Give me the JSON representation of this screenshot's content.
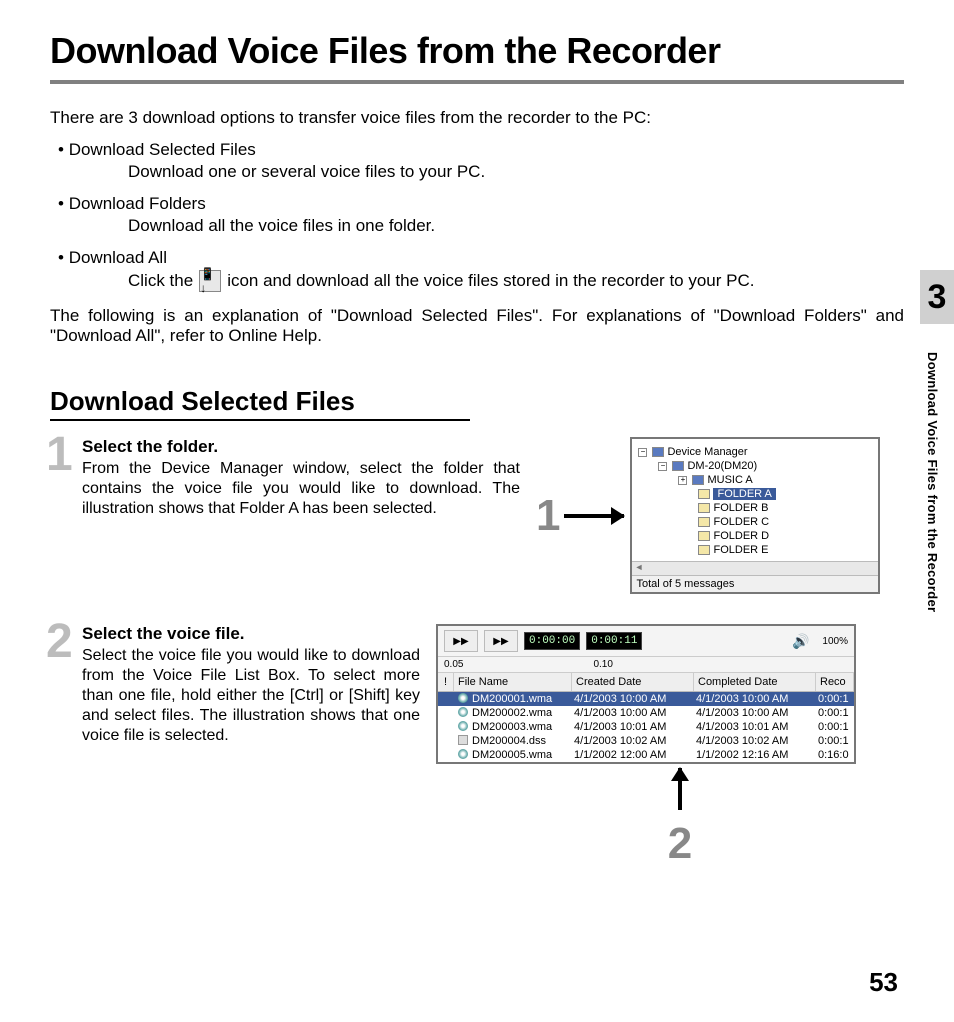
{
  "title": "Download Voice Files from the Recorder",
  "intro": "There are 3 download options to transfer voice files from the recorder to the PC:",
  "options": [
    {
      "head": "Download Selected Files",
      "body": "Download one or several voice files to your PC."
    },
    {
      "head": "Download Folders",
      "body": "Download all the voice files in one folder."
    },
    {
      "head": "Download All",
      "body_pre": "Click the",
      "body_post": "icon and download all the voice files stored in the recorder to your PC."
    }
  ],
  "after_options": "The following is an explanation of \"Download Selected Files\". For explanations of \"Download Folders\" and \"Download All\", refer to Online Help.",
  "chapter_number": "3",
  "side_label": "Download Voice Files from the Recorder",
  "section_title": "Download Selected Files",
  "step1": {
    "num": "1",
    "head": "Select the folder.",
    "body": "From the Device Manager window, select the folder that contains the voice file you would like to download. The illustration shows that Folder A has been selected.",
    "callout": "1"
  },
  "tree": {
    "root": "Device Manager",
    "device": "DM-20(DM20)",
    "items": [
      {
        "label": "MUSIC A",
        "type": "music"
      },
      {
        "label": "FOLDER A",
        "type": "folder",
        "selected": true
      },
      {
        "label": "FOLDER B",
        "type": "folder"
      },
      {
        "label": "FOLDER C",
        "type": "folder"
      },
      {
        "label": "FOLDER D",
        "type": "folder"
      },
      {
        "label": "FOLDER E",
        "type": "folder"
      }
    ],
    "status": "Total of 5 messages"
  },
  "step2": {
    "num": "2",
    "head": "Select the voice file.",
    "body": "Select the voice file you would like to download from the Voice File List Box. To select more than one file, hold either the [Ctrl] or [Shift] key and select files. The illustration shows that one voice file is selected.",
    "callout": "2"
  },
  "player": {
    "time_current": "0:00:00",
    "time_total": "0:00:11",
    "volume_label": "100%",
    "ruler_a": "0.05",
    "ruler_b": "0.10"
  },
  "list": {
    "headers": {
      "bang": "!",
      "filename": "File Name",
      "created": "Created Date",
      "completed": "Completed Date",
      "rec": "Reco"
    },
    "rows": [
      {
        "name": "DM200001.wma",
        "created": "4/1/2003 10:00 AM",
        "completed": "4/1/2003 10:00 AM",
        "rec": "0:00:1",
        "selected": true,
        "type": "wma"
      },
      {
        "name": "DM200002.wma",
        "created": "4/1/2003 10:00 AM",
        "completed": "4/1/2003 10:00 AM",
        "rec": "0:00:1",
        "type": "wma"
      },
      {
        "name": "DM200003.wma",
        "created": "4/1/2003 10:01 AM",
        "completed": "4/1/2003 10:01 AM",
        "rec": "0:00:1",
        "type": "wma"
      },
      {
        "name": "DM200004.dss",
        "created": "4/1/2003 10:02 AM",
        "completed": "4/1/2003 10:02 AM",
        "rec": "0:00:1",
        "type": "dss"
      },
      {
        "name": "DM200005.wma",
        "created": "1/1/2002 12:00 AM",
        "completed": "1/1/2002 12:16 AM",
        "rec": "0:16:0",
        "type": "wma"
      }
    ]
  },
  "page_number": "53"
}
